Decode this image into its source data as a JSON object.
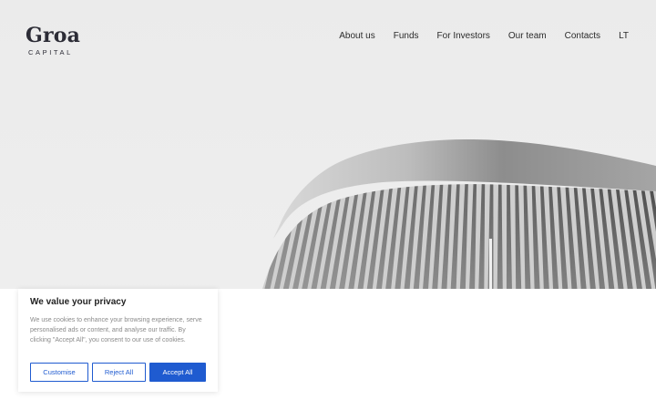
{
  "brand": {
    "name": "Groa",
    "tagline": "CAPITAL"
  },
  "nav": {
    "items": [
      "About us",
      "Funds",
      "For Investors",
      "Our team",
      "Contacts",
      "LT"
    ]
  },
  "hero": {
    "image": "architecture-building-photo"
  },
  "cookie_banner": {
    "title": "We value your privacy",
    "text": "We use cookies to enhance your browsing experience, serve personalised ads or content, and analyse our traffic. By clicking \"Accept All\", you consent to our use of cookies.",
    "buttons": {
      "customise": "Customise",
      "reject": "Reject All",
      "accept": "Accept All"
    }
  },
  "colors": {
    "accent": "#1f5bd0",
    "text_dark": "#2c2c36",
    "hero_bg": "#ececec"
  }
}
